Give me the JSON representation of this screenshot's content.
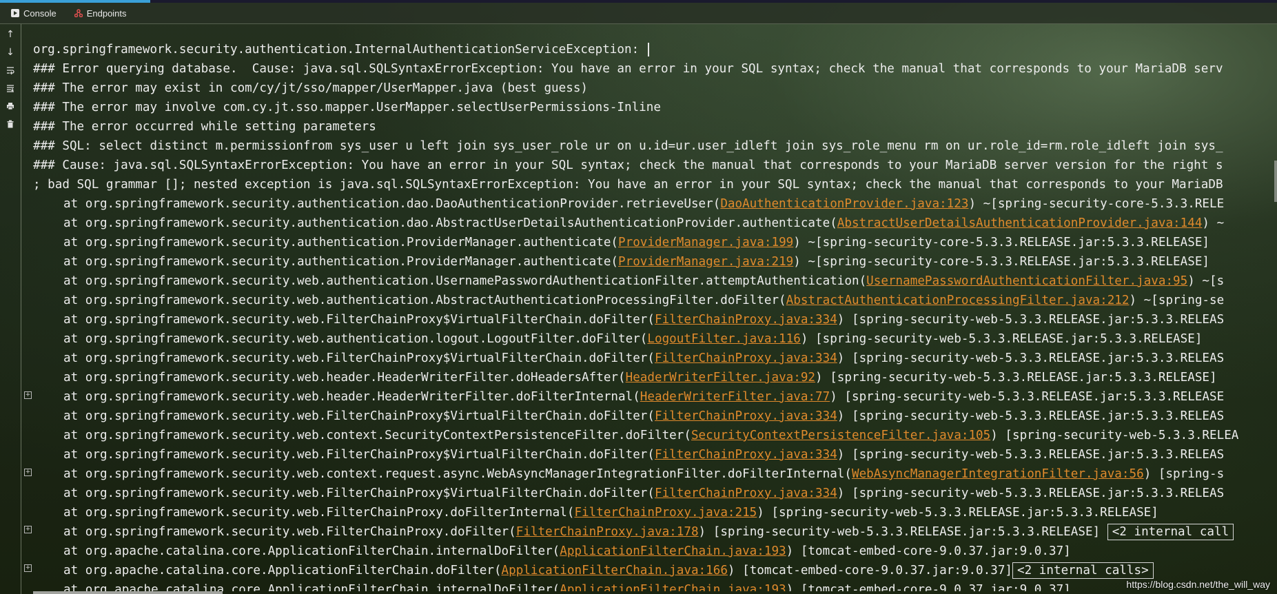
{
  "tabs": [
    {
      "label": "Console",
      "icon": "console-icon"
    },
    {
      "label": "Endpoints",
      "icon": "endpoints-icon"
    }
  ],
  "toolbar": [
    "up-arrow-icon",
    "down-arrow-icon",
    "soft-wrap-icon",
    "scroll-to-end-icon",
    "print-icon",
    "trash-icon"
  ],
  "console": {
    "lines": [
      {
        "type": "plain",
        "text": "org.springframework.security.authentication.InternalAuthenticationServiceException: ",
        "caret": true
      },
      {
        "type": "plain",
        "text": "### Error querying database.  Cause: java.sql.SQLSyntaxErrorException: You have an error in your SQL syntax; check the manual that corresponds to your MariaDB serv"
      },
      {
        "type": "plain",
        "text": "### The error may exist in com/cy/jt/sso/mapper/UserMapper.java (best guess)"
      },
      {
        "type": "plain",
        "text": "### The error may involve com.cy.jt.sso.mapper.UserMapper.selectUserPermissions-Inline"
      },
      {
        "type": "plain",
        "text": "### The error occurred while setting parameters"
      },
      {
        "type": "plain",
        "text": "### SQL: select distinct m.permissionfrom sys_user u left join sys_user_role ur on u.id=ur.user_idleft join sys_role_menu rm on ur.role_id=rm.role_idleft join sys_"
      },
      {
        "type": "plain",
        "text": "### Cause: java.sql.SQLSyntaxErrorException: You have an error in your SQL syntax; check the manual that corresponds to your MariaDB server version for the right s"
      },
      {
        "type": "plain",
        "text": "; bad SQL grammar []; nested exception is java.sql.SQLSyntaxErrorException: You have an error in your SQL syntax; check the manual that corresponds to your MariaDB"
      },
      {
        "type": "frame",
        "pre": "at org.springframework.security.authentication.dao.DaoAuthenticationProvider.retrieveUser(",
        "link": "DaoAuthenticationProvider.java:123",
        "post": ") ~[spring-security-core-5.3.3.RELE"
      },
      {
        "type": "frame",
        "pre": "at org.springframework.security.authentication.dao.AbstractUserDetailsAuthenticationProvider.authenticate(",
        "link": "AbstractUserDetailsAuthenticationProvider.java:144",
        "post": ") ~"
      },
      {
        "type": "frame",
        "pre": "at org.springframework.security.authentication.ProviderManager.authenticate(",
        "link": "ProviderManager.java:199",
        "post": ") ~[spring-security-core-5.3.3.RELEASE.jar:5.3.3.RELEASE]"
      },
      {
        "type": "frame",
        "pre": "at org.springframework.security.authentication.ProviderManager.authenticate(",
        "link": "ProviderManager.java:219",
        "post": ") ~[spring-security-core-5.3.3.RELEASE.jar:5.3.3.RELEASE]"
      },
      {
        "type": "frame",
        "pre": "at org.springframework.security.web.authentication.UsernamePasswordAuthenticationFilter.attemptAuthentication(",
        "link": "UsernamePasswordAuthenticationFilter.java:95",
        "post": ") ~[s"
      },
      {
        "type": "frame",
        "pre": "at org.springframework.security.web.authentication.AbstractAuthenticationProcessingFilter.doFilter(",
        "link": "AbstractAuthenticationProcessingFilter.java:212",
        "post": ") ~[spring-se"
      },
      {
        "type": "frame",
        "pre": "at org.springframework.security.web.FilterChainProxy$VirtualFilterChain.doFilter(",
        "link": "FilterChainProxy.java:334",
        "post": ") [spring-security-web-5.3.3.RELEASE.jar:5.3.3.RELEAS"
      },
      {
        "type": "frame",
        "pre": "at org.springframework.security.web.authentication.logout.LogoutFilter.doFilter(",
        "link": "LogoutFilter.java:116",
        "post": ") [spring-security-web-5.3.3.RELEASE.jar:5.3.3.RELEASE]"
      },
      {
        "type": "frame",
        "pre": "at org.springframework.security.web.FilterChainProxy$VirtualFilterChain.doFilter(",
        "link": "FilterChainProxy.java:334",
        "post": ") [spring-security-web-5.3.3.RELEASE.jar:5.3.3.RELEAS"
      },
      {
        "type": "frame",
        "pre": "at org.springframework.security.web.header.HeaderWriterFilter.doHeadersAfter(",
        "link": "HeaderWriterFilter.java:92",
        "post": ") [spring-security-web-5.3.3.RELEASE.jar:5.3.3.RELEASE]"
      },
      {
        "type": "frame",
        "pre": "at org.springframework.security.web.header.HeaderWriterFilter.doFilterInternal(",
        "link": "HeaderWriterFilter.java:77",
        "post": ") [spring-security-web-5.3.3.RELEASE.jar:5.3.3.RELEASE",
        "fold": true
      },
      {
        "type": "frame",
        "pre": "at org.springframework.security.web.FilterChainProxy$VirtualFilterChain.doFilter(",
        "link": "FilterChainProxy.java:334",
        "post": ") [spring-security-web-5.3.3.RELEASE.jar:5.3.3.RELEAS"
      },
      {
        "type": "frame",
        "pre": "at org.springframework.security.web.context.SecurityContextPersistenceFilter.doFilter(",
        "link": "SecurityContextPersistenceFilter.java:105",
        "post": ") [spring-security-web-5.3.3.RELEA"
      },
      {
        "type": "frame",
        "pre": "at org.springframework.security.web.FilterChainProxy$VirtualFilterChain.doFilter(",
        "link": "FilterChainProxy.java:334",
        "post": ") [spring-security-web-5.3.3.RELEASE.jar:5.3.3.RELEAS"
      },
      {
        "type": "frame",
        "pre": "at org.springframework.security.web.context.request.async.WebAsyncManagerIntegrationFilter.doFilterInternal(",
        "link": "WebAsyncManagerIntegrationFilter.java:56",
        "post": ") [spring-s",
        "fold": true
      },
      {
        "type": "frame",
        "pre": "at org.springframework.security.web.FilterChainProxy$VirtualFilterChain.doFilter(",
        "link": "FilterChainProxy.java:334",
        "post": ") [spring-security-web-5.3.3.RELEASE.jar:5.3.3.RELEAS"
      },
      {
        "type": "frame",
        "pre": "at org.springframework.security.web.FilterChainProxy.doFilterInternal(",
        "link": "FilterChainProxy.java:215",
        "post": ") [spring-security-web-5.3.3.RELEASE.jar:5.3.3.RELEASE]"
      },
      {
        "type": "frame",
        "pre": "at org.springframework.security.web.FilterChainProxy.doFilter(",
        "link": "FilterChainProxy.java:178",
        "post": ") [spring-security-web-5.3.3.RELEASE.jar:5.3.3.RELEASE] ",
        "internal": "<2 internal call",
        "fold": true
      },
      {
        "type": "frame",
        "pre": "at org.apache.catalina.core.ApplicationFilterChain.internalDoFilter(",
        "link": "ApplicationFilterChain.java:193",
        "post": ") [tomcat-embed-core-9.0.37.jar:9.0.37]"
      },
      {
        "type": "frame",
        "pre": "at org.apache.catalina.core.ApplicationFilterChain.doFilter(",
        "link": "ApplicationFilterChain.java:166",
        "post": ") [tomcat-embed-core-9.0.37.jar:9.0.37]",
        "internal": "<2 internal calls>",
        "fold": true
      },
      {
        "type": "frame",
        "pre": "at org.apache.catalina.core.ApplicationFilterChain.internalDoFilter(",
        "link": "ApplicationFilterChain.java:193",
        "post": ") [tomcat-embed-core-9.0.37.jar:9.0.37]"
      }
    ]
  },
  "watermark": "https://blog.csdn.net/the_will_way"
}
